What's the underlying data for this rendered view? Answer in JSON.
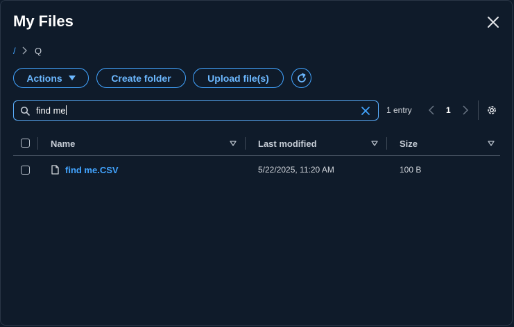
{
  "title": "My Files",
  "breadcrumb": {
    "root": "/",
    "current": "Q"
  },
  "toolbar": {
    "actions_label": "Actions",
    "create_folder_label": "Create folder",
    "upload_label": "Upload file(s)"
  },
  "search": {
    "value": "find me",
    "placeholder": ""
  },
  "pagination": {
    "entry_count": "1 entry",
    "current_page": "1"
  },
  "table": {
    "columns": [
      "Name",
      "Last modified",
      "Size"
    ],
    "rows": [
      {
        "name": "find me.CSV",
        "modified": "5/22/2025, 11:20 AM",
        "size": "100 B",
        "type": "file"
      }
    ]
  },
  "colors": {
    "accent": "#42a4ff",
    "background": "#0f1b2a",
    "border": "#414d5c"
  },
  "icons": [
    "close-icon",
    "chevron-right-icon",
    "caret-down-icon",
    "refresh-icon",
    "search-icon",
    "clear-icon",
    "chevron-left-icon",
    "settings-icon",
    "sort-icon",
    "file-icon"
  ]
}
